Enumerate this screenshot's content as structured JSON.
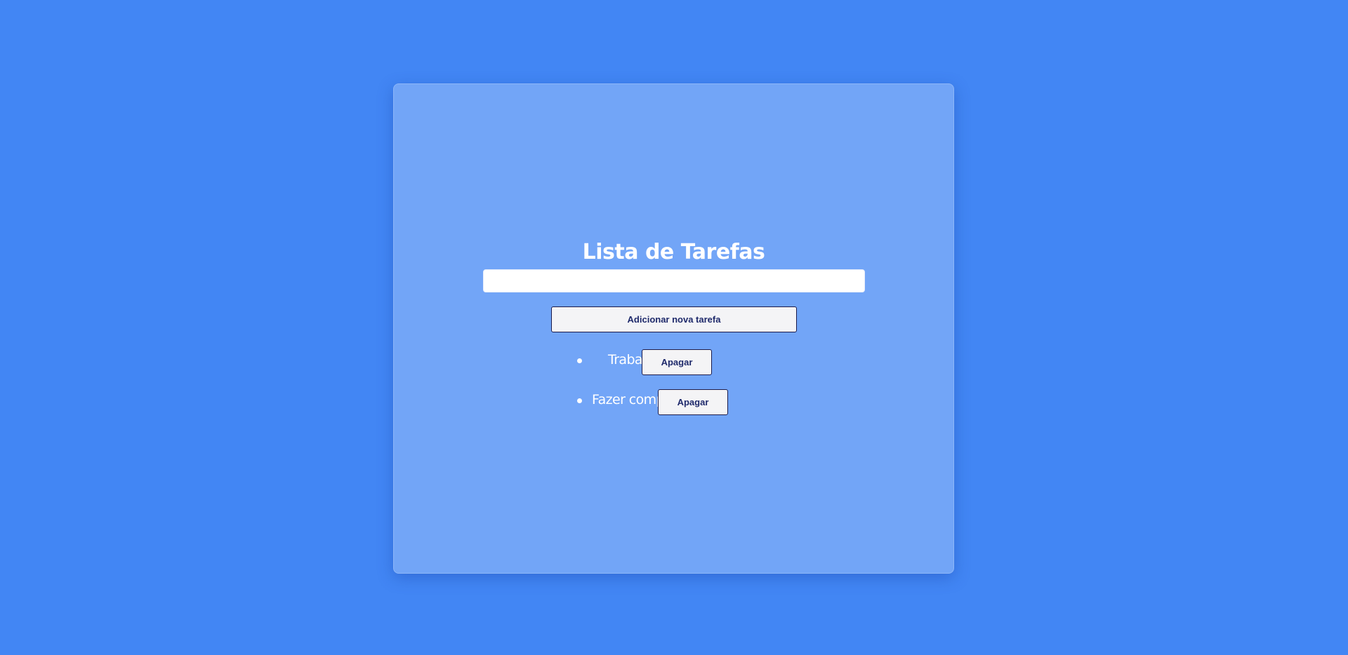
{
  "app": {
    "title": "Lista de Tarefas"
  },
  "form": {
    "input_value": "",
    "input_placeholder": "",
    "add_button_label": "Adicionar nova tarefa"
  },
  "tasks": [
    {
      "label": "Trabalhar",
      "delete_label": "Apagar"
    },
    {
      "label": "Fazer compras",
      "delete_label": "Apagar"
    }
  ],
  "colors": {
    "page_background": "#4286f4",
    "card_background": "#72a5f7",
    "button_text": "#1f2a6b",
    "button_border": "#1b1b4a"
  }
}
